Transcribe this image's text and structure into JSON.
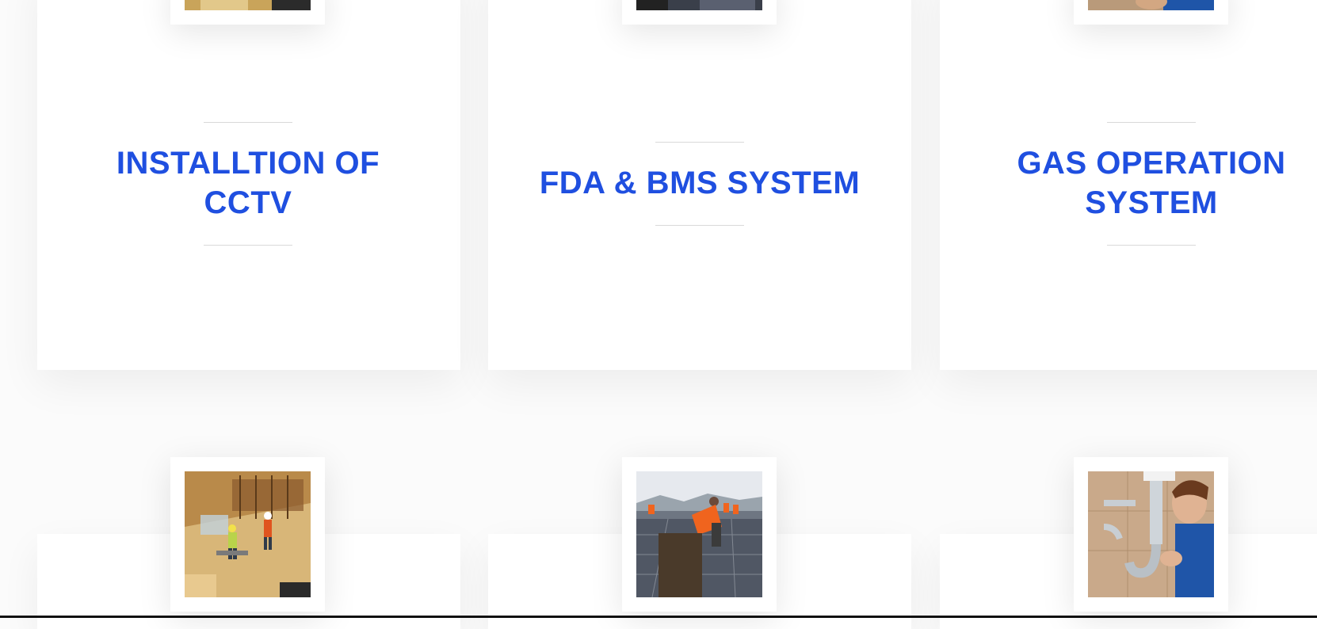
{
  "services": [
    {
      "title": "INSTALLTION OF CCTV",
      "title_line1": "INSTALLTION OF",
      "title_line2": "CCTV",
      "image_icon": "construction-workers-photo"
    },
    {
      "title": "FDA & BMS SYSTEM",
      "image_icon": "solar-panel-workers-photo"
    },
    {
      "title": "GAS OPERATION SYSTEM",
      "title_line1": "GAS OPERATION",
      "title_line2": "SYSTEM",
      "image_icon": "plumber-pipe-photo"
    }
  ],
  "colors": {
    "title": "#1f4fe0",
    "page_bg": "#fbfbfb",
    "card_bg": "#ffffff",
    "rule": "#d9d9d9"
  }
}
